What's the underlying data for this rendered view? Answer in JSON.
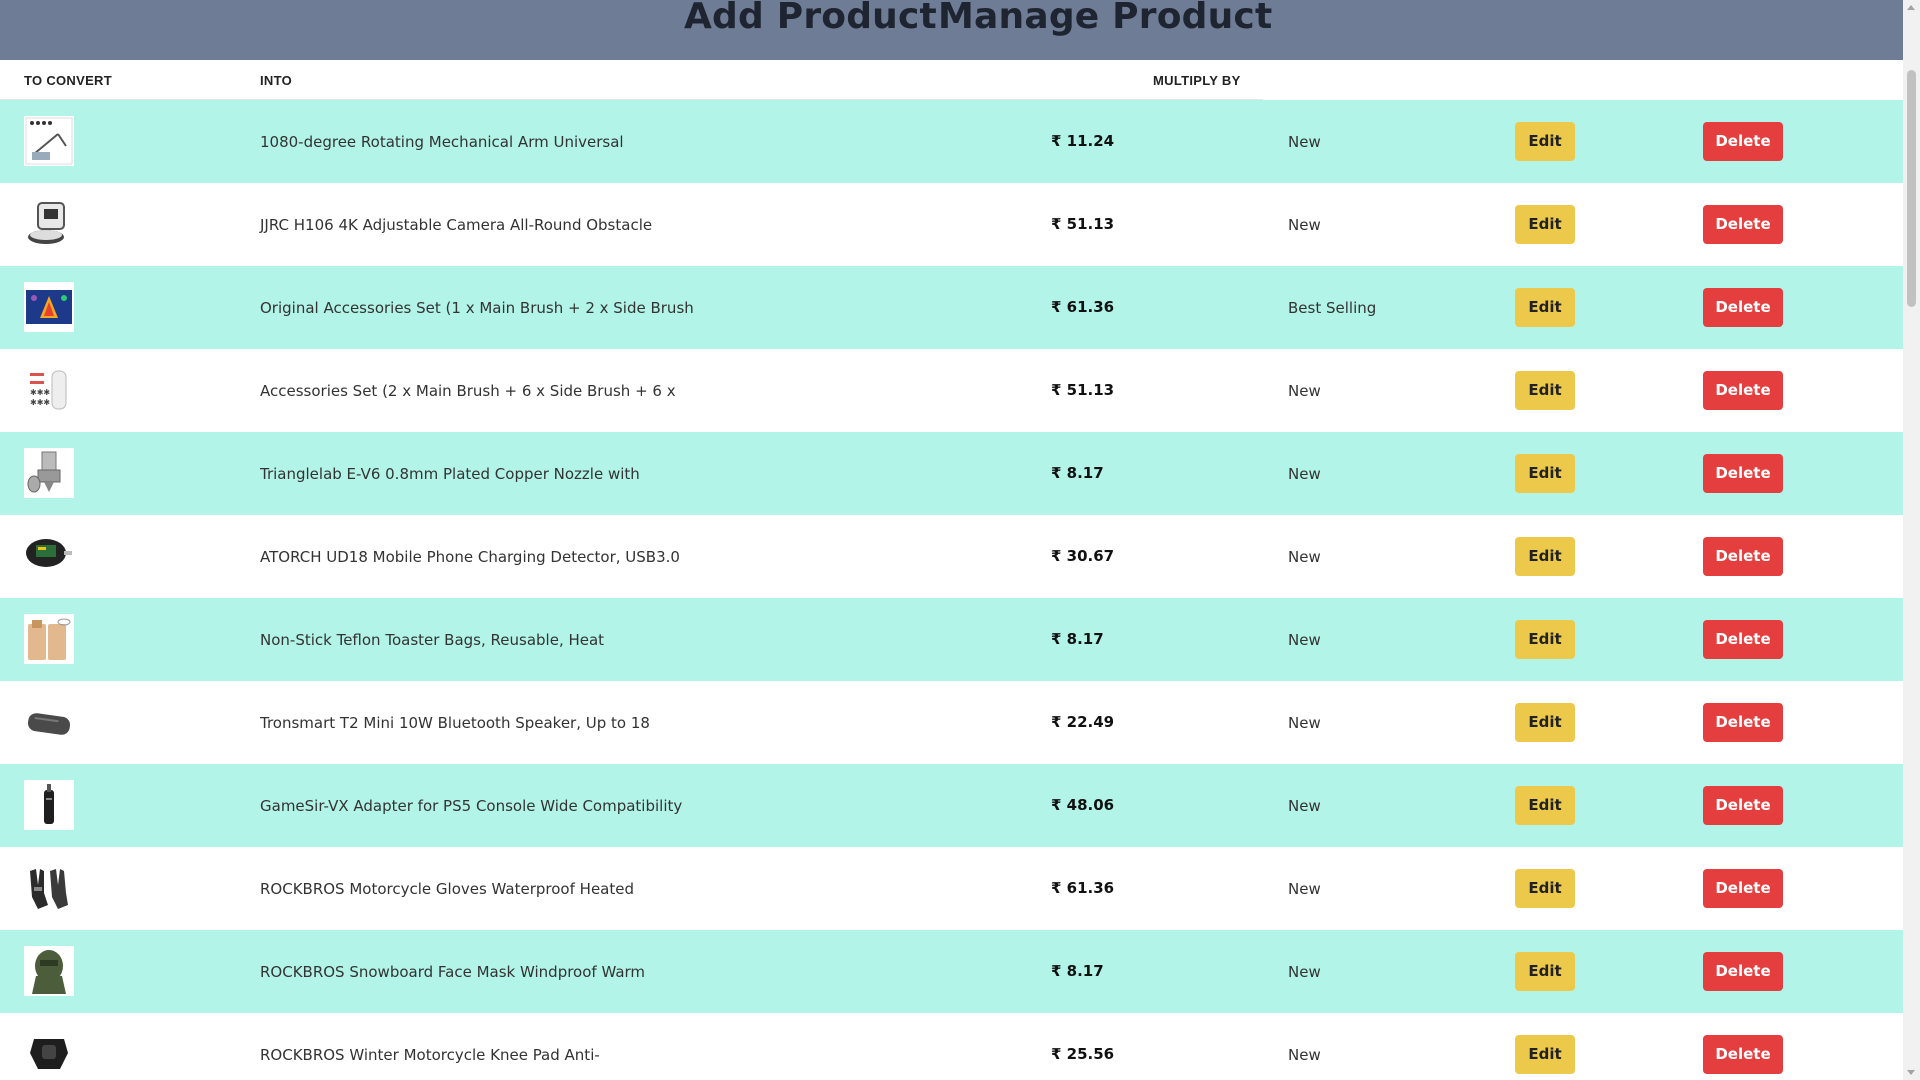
{
  "nav": {
    "add_product": "Add Product",
    "manage_product": "Manage Product"
  },
  "table": {
    "headers": [
      "TO CONVERT",
      "INTO",
      "MULTIPLY BY"
    ],
    "edit_label": "Edit",
    "delete_label": "Delete",
    "rows": [
      {
        "name": "1080-degree Rotating Mechanical Arm Universal",
        "price": "₹ 11.24",
        "tag": "New",
        "icon": "mechanical-arm-thumbnail"
      },
      {
        "name": "JJRC H106 4K Adjustable Camera All-Round Obstacle",
        "price": "₹ 51.13",
        "tag": "New",
        "icon": "robot-vacuum-thumbnail"
      },
      {
        "name": "Original Accessories Set (1 x Main Brush + 2 x Side Brush",
        "price": "₹ 61.36",
        "tag": "Best Selling",
        "icon": "accessories-set-thumbnail"
      },
      {
        "name": "Accessories Set (2 x Main Brush + 6 x Side Brush + 6 x",
        "price": "₹ 51.13",
        "tag": "New",
        "icon": "brush-set-thumbnail"
      },
      {
        "name": "Trianglelab E-V6 0.8mm Plated Copper Nozzle with",
        "price": "₹ 8.17",
        "tag": "New",
        "icon": "nozzle-thumbnail"
      },
      {
        "name": "ATORCH UD18 Mobile Phone Charging Detector, USB3.0",
        "price": "₹ 30.67",
        "tag": "New",
        "icon": "usb-detector-thumbnail"
      },
      {
        "name": "Non-Stick Teflon Toaster Bags, Reusable, Heat",
        "price": "₹ 8.17",
        "tag": "New",
        "icon": "toaster-bags-thumbnail"
      },
      {
        "name": "Tronsmart T2 Mini 10W Bluetooth Speaker, Up to 18",
        "price": "₹ 22.49",
        "tag": "New",
        "icon": "speaker-thumbnail"
      },
      {
        "name": "GameSir-VX Adapter for PS5 Console Wide Compatibility",
        "price": "₹ 48.06",
        "tag": "New",
        "icon": "adapter-thumbnail"
      },
      {
        "name": "ROCKBROS Motorcycle Gloves Waterproof Heated",
        "price": "₹ 61.36",
        "tag": "New",
        "icon": "gloves-thumbnail"
      },
      {
        "name": "ROCKBROS Snowboard Face Mask Windproof Warm",
        "price": "₹ 8.17",
        "tag": "New",
        "icon": "face-mask-thumbnail"
      },
      {
        "name": "ROCKBROS Winter Motorcycle Knee Pad Anti-",
        "price": "₹ 25.56",
        "tag": "New",
        "icon": "knee-pad-thumbnail"
      }
    ]
  },
  "colors": {
    "topbar": "#6e7c95",
    "row_alt": "#b2f4e8",
    "edit_button": "#ecc94b",
    "delete_button": "#e53e3e"
  }
}
